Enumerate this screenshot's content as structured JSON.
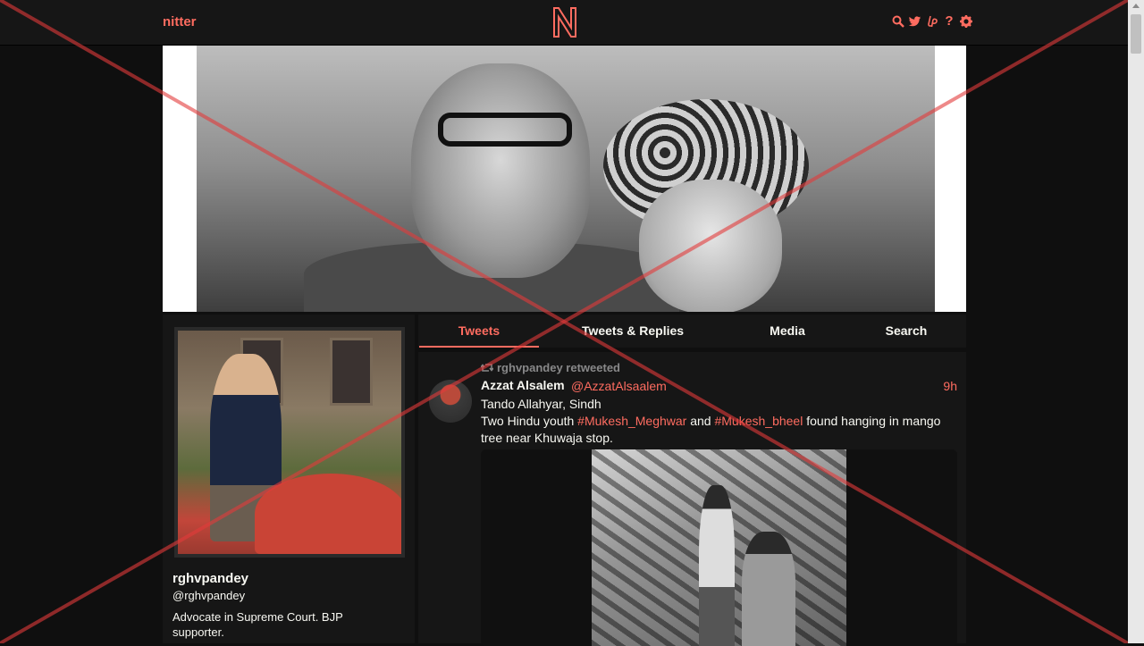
{
  "navbar": {
    "brand": "nitter",
    "logo_letter": "N",
    "help_glyph": "?",
    "icons": [
      "search-icon",
      "twitter-bird-icon",
      "liberapay-icon",
      "help-icon",
      "gear-icon"
    ]
  },
  "profile": {
    "fullname": "rghvpandey",
    "username": "@rghvpandey",
    "bio": "Advocate in Supreme Court. BJP supporter."
  },
  "tabs": [
    "Tweets",
    "Tweets & Replies",
    "Media",
    "Search"
  ],
  "active_tab": "Tweets",
  "timeline": {
    "tweet": {
      "retweet_header": "rghvpandey retweeted",
      "fullname": "Azzat Alsalem",
      "username": "@AzzatAlsaalem",
      "date": "9h",
      "content_line1": "Tando Allahyar, Sindh",
      "content_prefix": "Two Hindu youth ",
      "hashtag1": "#Mukesh_Meghwar",
      "content_and": " and ",
      "hashtag2": "#Mukesh_bheel",
      "content_suffix": " found hanging in mango tree near Khuwaja stop."
    }
  },
  "colors": {
    "accent": "#ff6c60",
    "background": "#0f0f0f",
    "panel": "#161616",
    "text": "#f8f8f2",
    "muted": "#888889",
    "overlay_cross": "#e23b3b"
  }
}
